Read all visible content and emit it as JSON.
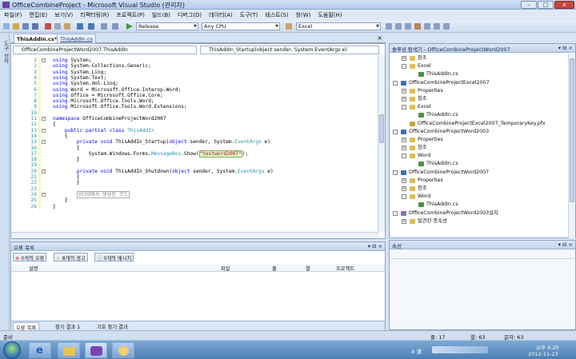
{
  "window": {
    "title": "OfficeCombineProject - Microsoft Visual Studio (관리자)"
  },
  "menu": [
    "파일(F)",
    "편집(E)",
    "보기(V)",
    "리팩터링(R)",
    "프로젝트(P)",
    "빌드(B)",
    "디버그(D)",
    "데이터(A)",
    "도구(T)",
    "테스트(S)",
    "창(W)",
    "도움말(H)"
  ],
  "toolbar": {
    "config": "Release",
    "platform": "Any CPU",
    "find": "Excel"
  },
  "left_strip": "도구 상자",
  "editor": {
    "tabs": [
      "ThisAddIn.cs*",
      "ThisAddIn.cs"
    ],
    "close": "×",
    "nav_left": "OfficeCombineProjectWord2007.ThisAddIn",
    "nav_right": "ThisAddIn_Startup(object sender, System.EventArgs e)",
    "line_numbers": [
      "1",
      "2",
      "3",
      "4",
      "5",
      "6",
      "7",
      "8",
      "9",
      "10",
      "11",
      "12",
      "13",
      "14",
      "15",
      "16",
      "17",
      "18",
      "19",
      "20",
      "21",
      "22",
      "23",
      "24",
      "25",
      "26"
    ],
    "lines": [
      "using System;",
      "using System.Collections.Generic;",
      "using System.Linq;",
      "using System.Text;",
      "using System.Xml.Linq;",
      "using Word = Microsoft.Office.Interop.Word;",
      "using Office = Microsoft.Office.Core;",
      "using Microsoft.Office.Tools.Word;",
      "using Microsoft.Office.Tools.Word.Extensions;",
      "",
      "namespace OfficeCombineProjectWord2007",
      "{",
      "    public partial class ThisAddIn",
      "    {",
      "        private void ThisAddIn_Startup(object sender, System.EventArgs e)",
      "        {",
      "            System.Windows.Forms.MessageBox.Show(\"testword2007\");",
      "        }",
      "",
      "        private void ThisAddIn_Shutdown(object sender, System.EventArgs e)",
      "        {",
      "        }",
      "",
      "        VSTO에서 생성한 코드",
      "    }",
      "}"
    ]
  },
  "error_list": {
    "title": "오류 목록",
    "pin": "▾ ⊟ ×",
    "errors": "0개의 오류",
    "warnings": "8개의 경고",
    "messages": "0개의 메시지",
    "columns": [
      "설명",
      "파일",
      "줄",
      "열",
      "프로젝트"
    ],
    "bottom_tabs": [
      "오류 목록",
      "찾기 결과 1",
      "기호 찾기 결과"
    ]
  },
  "solution_explorer": {
    "title": "솔루션 탐색기 - OfficeCombineProjectWord2007",
    "pin": "▾ ⊟ ×",
    "items": [
      {
        "label": "참조",
        "indent": 1,
        "exp": "+",
        "icon": "folder"
      },
      {
        "label": "Excel",
        "indent": 1,
        "exp": "-",
        "icon": "folder"
      },
      {
        "label": "ThisAddIn.cs",
        "indent": 2,
        "exp": "",
        "icon": "cs"
      },
      {
        "label": "OfficeCombineProjectExcel2007",
        "indent": 0,
        "exp": "-",
        "icon": "project"
      },
      {
        "label": "Properties",
        "indent": 1,
        "exp": "+",
        "icon": "folder"
      },
      {
        "label": "참조",
        "indent": 1,
        "exp": "+",
        "icon": "folder"
      },
      {
        "label": "Excel",
        "indent": 1,
        "exp": "-",
        "icon": "folder"
      },
      {
        "label": "ThisAddIn.cs",
        "indent": 2,
        "exp": "",
        "icon": "cs"
      },
      {
        "label": "OfficeCombineProjectExcel2007_TemporaryKey.pfx",
        "indent": 1,
        "exp": "",
        "icon": "key"
      },
      {
        "label": "OfficeCombineProjectWord2003",
        "indent": 0,
        "exp": "-",
        "icon": "project"
      },
      {
        "label": "Properties",
        "indent": 1,
        "exp": "+",
        "icon": "folder"
      },
      {
        "label": "참조",
        "indent": 1,
        "exp": "+",
        "icon": "folder"
      },
      {
        "label": "Word",
        "indent": 1,
        "exp": "-",
        "icon": "folder"
      },
      {
        "label": "ThisAddIn.cs",
        "indent": 2,
        "exp": "",
        "icon": "cs"
      },
      {
        "label": "OfficeCombineProjectWord2007",
        "indent": 0,
        "exp": "-",
        "icon": "project"
      },
      {
        "label": "Properties",
        "indent": 1,
        "exp": "+",
        "icon": "folder"
      },
      {
        "label": "참조",
        "indent": 1,
        "exp": "+",
        "icon": "folder"
      },
      {
        "label": "Word",
        "indent": 1,
        "exp": "-",
        "icon": "folder"
      },
      {
        "label": "ThisAddIn.cs",
        "indent": 2,
        "exp": "",
        "icon": "cs"
      },
      {
        "label": "OfficeCombineProjectWord2003설치",
        "indent": 0,
        "exp": "-",
        "icon": "setup"
      },
      {
        "label": "발견된 종속성",
        "indent": 1,
        "exp": "+",
        "icon": "folder"
      }
    ]
  },
  "properties": {
    "title": "속성",
    "pin": "▾ ⊟ ×"
  },
  "status": {
    "ready": "준비",
    "line": "줄: 17",
    "col": "열: 63",
    "chars": "문자: 63"
  },
  "taskbar": {
    "lang": "A 漢",
    "time": "오후 4:20",
    "date": "2012-11-23"
  },
  "colors": {
    "keyword": "#0000ff",
    "type": "#2b91af",
    "string": "#a31515",
    "accent": "#3a6db5"
  }
}
